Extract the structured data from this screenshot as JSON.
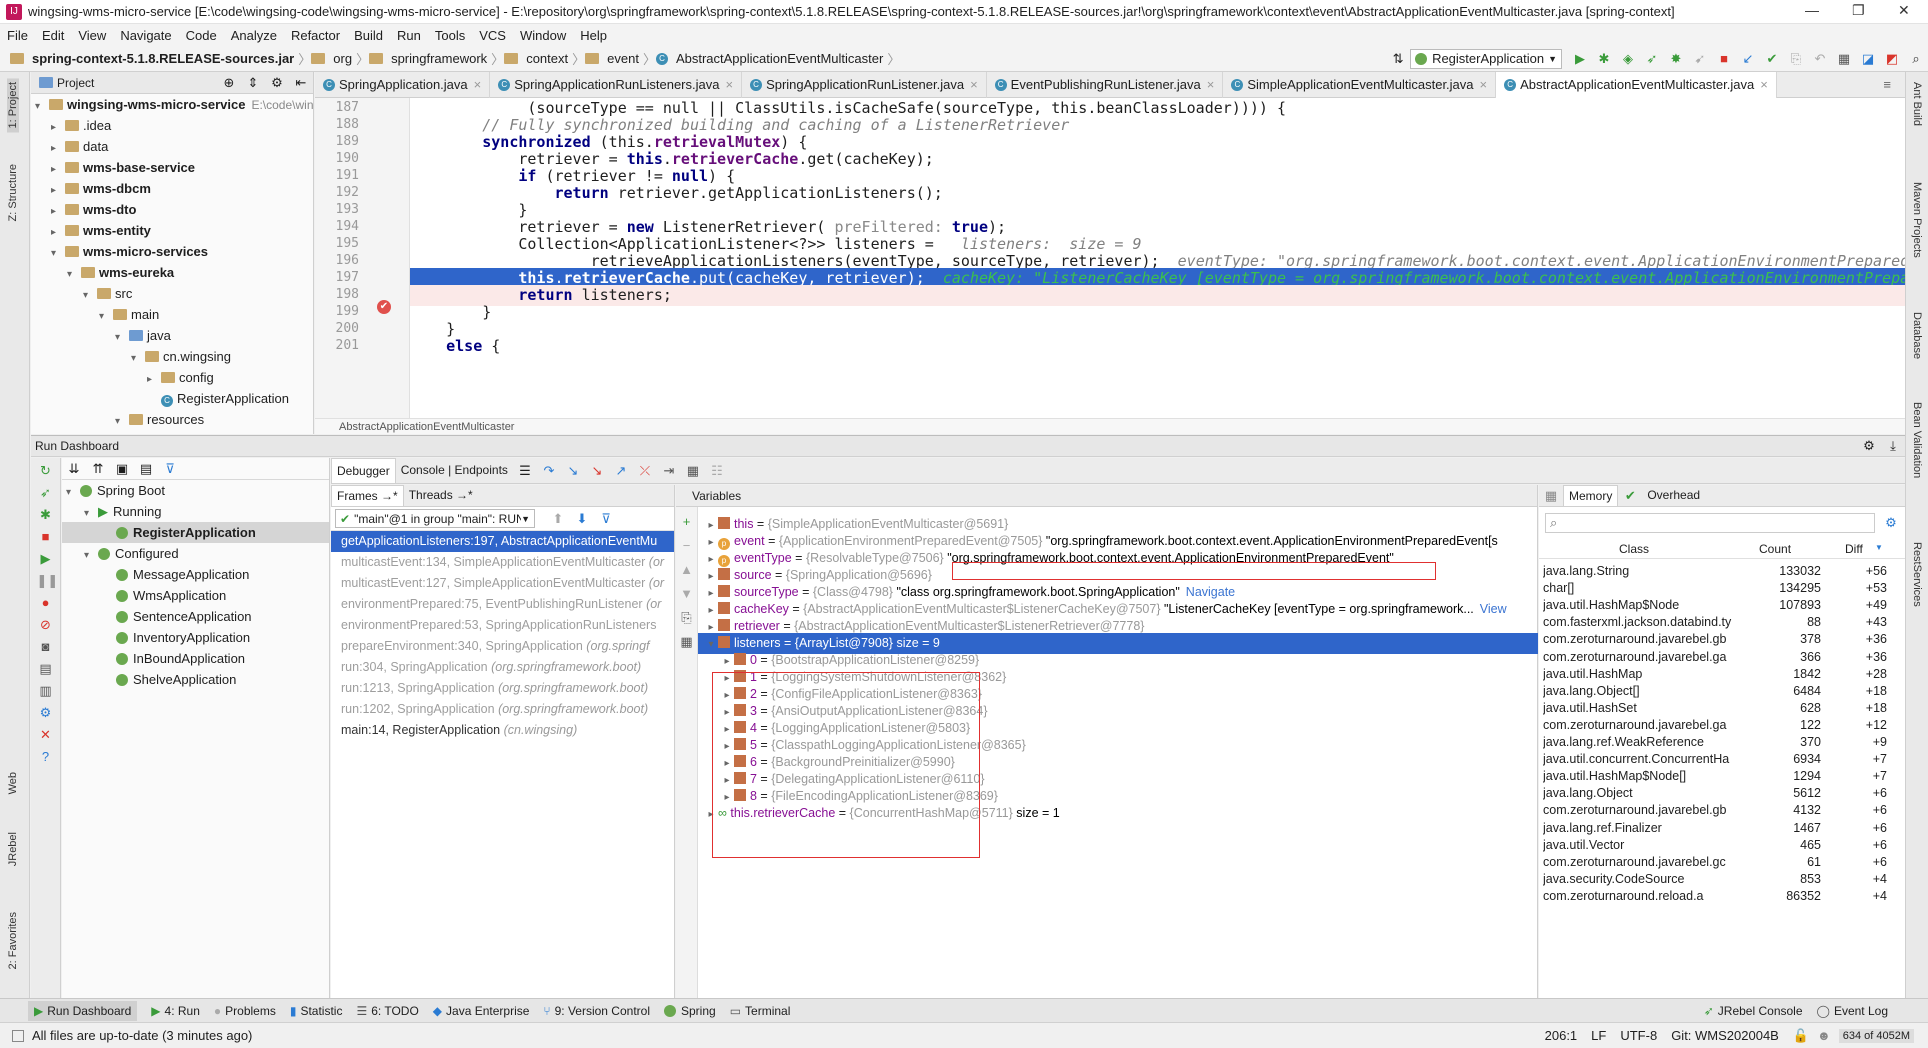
{
  "window": {
    "title": "wingsing-wms-micro-service [E:\\code\\wingsing-code\\wingsing-wms-micro-service] - E:\\repository\\org\\springframework\\spring-context\\5.1.8.RELEASE\\spring-context-5.1.8.RELEASE-sources.jar!\\org\\springframework\\context\\event\\AbstractApplicationEventMulticaster.java [spring-context]",
    "minimize": "—",
    "maximize": "❐",
    "close": "✕"
  },
  "menu": [
    "File",
    "Edit",
    "View",
    "Navigate",
    "Code",
    "Analyze",
    "Refactor",
    "Build",
    "Run",
    "Tools",
    "VCS",
    "Window",
    "Help"
  ],
  "breadcrumb": [
    "spring-context-5.1.8.RELEASE-sources.jar",
    "org",
    "springframework",
    "context",
    "event",
    "AbstractApplicationEventMulticaster"
  ],
  "run_config": "RegisterApplication",
  "left_strip": [
    "1: Project",
    "Z: Structure",
    "Web",
    "JRebel",
    "2: Favorites"
  ],
  "right_strip": [
    "Ant Build",
    "Maven Projects",
    "Database",
    "Bean Validation",
    "RestServices"
  ],
  "project": {
    "header": "Project",
    "items": [
      {
        "label": "wingsing-wms-micro-service",
        "extra": "E:\\code\\wing",
        "depth": 0,
        "arrow": "▾",
        "bold": true
      },
      {
        "label": ".idea",
        "depth": 1,
        "arrow": "▸"
      },
      {
        "label": "data",
        "depth": 1,
        "arrow": "▸"
      },
      {
        "label": "wms-base-service",
        "depth": 1,
        "arrow": "▸",
        "bold": true
      },
      {
        "label": "wms-dbcm",
        "depth": 1,
        "arrow": "▸",
        "bold": true
      },
      {
        "label": "wms-dto",
        "depth": 1,
        "arrow": "▸",
        "bold": true
      },
      {
        "label": "wms-entity",
        "depth": 1,
        "arrow": "▸",
        "bold": true
      },
      {
        "label": "wms-micro-services",
        "depth": 1,
        "arrow": "▾",
        "bold": true
      },
      {
        "label": "wms-eureka",
        "depth": 2,
        "arrow": "▾",
        "bold": true
      },
      {
        "label": "src",
        "depth": 3,
        "arrow": "▾"
      },
      {
        "label": "main",
        "depth": 4,
        "arrow": "▾"
      },
      {
        "label": "java",
        "depth": 5,
        "arrow": "▾",
        "blue": true
      },
      {
        "label": "cn.wingsing",
        "depth": 6,
        "arrow": "▾"
      },
      {
        "label": "config",
        "depth": 7,
        "arrow": "▸"
      },
      {
        "label": "RegisterApplication",
        "depth": 7,
        "arrow": "",
        "cls": true
      },
      {
        "label": "resources",
        "depth": 5,
        "arrow": "▾"
      }
    ]
  },
  "editor": {
    "tabs": [
      {
        "label": "SpringApplication.java",
        "active": false
      },
      {
        "label": "SpringApplicationRunListeners.java",
        "active": false
      },
      {
        "label": "SpringApplicationRunListener.java",
        "active": false
      },
      {
        "label": "EventPublishingRunListener.java",
        "active": false
      },
      {
        "label": "SimpleApplicationEventMulticaster.java",
        "active": false
      },
      {
        "label": "AbstractApplicationEventMulticaster.java",
        "active": true
      }
    ],
    "line_numbers": [
      "187",
      "188",
      "189",
      "190",
      "191",
      "192",
      "193",
      "194",
      "195",
      "196",
      "197",
      "198",
      "199",
      "200",
      "201"
    ],
    "footer": "AbstractApplicationEventMulticaster",
    "lines": {
      "l187": "(sourceType == null || ClassUtils.isCacheSafe(sourceType, this.beanClassLoader)))) {",
      "l188": "// Fully synchronized building and caching of a ListenerRetriever",
      "l189a": "synchronized",
      "l189b": " (this.",
      "l189c": "retrievalMutex",
      "l189d": ") {",
      "l190a": "retriever = ",
      "l190b": "this",
      "l190c": ".",
      "l190d": "retrieverCache",
      "l190e": ".get(cacheKey);",
      "l191a": "if",
      "l191b": " (retriever != ",
      "l191c": "null",
      "l191d": ") {",
      "l192a": "return",
      "l192b": " retriever.getApplicationListeners();",
      "l193": "}",
      "l194a": "retriever = ",
      "l194b": "new",
      "l194c": " ListenerRetriever( ",
      "l194d": "preFiltered:",
      "l194e": " true",
      "l194f": ");",
      "l195a": "Collection<ApplicationListener<?>> listeners = ",
      "l195b": "listeners:  size = 9",
      "l196a": "retrieveApplicationListeners(eventType, sourceType, retriever);",
      "l196b": "eventType: \"org.springframework.boot.context.event.ApplicationEnvironmentPreparedEvent\"",
      "l197a": "this",
      "l197b": ".",
      "l197c": "retrieverCache",
      "l197d": ".put(cacheKey, retriever);",
      "l197e": "cacheKey: \"ListenerCacheKey [eventType = org.springframework.boot.context.event.ApplicationEnvironmentPreparedEvent",
      "l198a": "return",
      "l198b": " listeners;",
      "l199": "}",
      "l200": "}",
      "l201a": "else",
      "l201b": " {"
    }
  },
  "run_dashboard": {
    "title": "Run Dashboard",
    "tree": [
      {
        "label": "Spring Boot",
        "depth": 0,
        "arrow": "▾"
      },
      {
        "label": "Running",
        "depth": 1,
        "arrow": "▾",
        "run": true
      },
      {
        "label": "RegisterApplication",
        "depth": 2,
        "arrow": "",
        "selected": true
      },
      {
        "label": "Configured",
        "depth": 1,
        "arrow": "▾"
      },
      {
        "label": "MessageApplication",
        "depth": 2,
        "arrow": ""
      },
      {
        "label": "WmsApplication",
        "depth": 2,
        "arrow": ""
      },
      {
        "label": "SentenceApplication",
        "depth": 2,
        "arrow": ""
      },
      {
        "label": "InventoryApplication",
        "depth": 2,
        "arrow": ""
      },
      {
        "label": "InBoundApplication",
        "depth": 2,
        "arrow": ""
      },
      {
        "label": "ShelveApplication",
        "depth": 2,
        "arrow": ""
      }
    ]
  },
  "debugger": {
    "tabs": [
      "Debugger",
      "Console | Endpoints"
    ],
    "frames_tab": "Frames →*",
    "threads_tab": "Threads →*",
    "thread_select": "\"main\"@1 in group \"main\": RUNN...",
    "frames": [
      {
        "m": "getApplicationListeners:197, AbstractApplicationEventMu",
        "c": "",
        "style": "sel"
      },
      {
        "m": "multicastEvent:134, SimpleApplicationEventMulticaster ",
        "c": "(or",
        "style": "dim"
      },
      {
        "m": "multicastEvent:127, SimpleApplicationEventMulticaster ",
        "c": "(or",
        "style": "dim"
      },
      {
        "m": "environmentPrepared:75, EventPublishingRunListener ",
        "c": "(or",
        "style": "dim"
      },
      {
        "m": "environmentPrepared:53, SpringApplicationRunListeners",
        "c": "",
        "style": "dim"
      },
      {
        "m": "prepareEnvironment:340, SpringApplication ",
        "c": "(org.springf",
        "style": "dim"
      },
      {
        "m": "run:304, SpringApplication ",
        "c": "(org.springframework.boot)",
        "style": "dim"
      },
      {
        "m": "run:1213, SpringApplication ",
        "c": "(org.springframework.boot)",
        "style": "dim"
      },
      {
        "m": "run:1202, SpringApplication ",
        "c": "(org.springframework.boot)",
        "style": "dim"
      },
      {
        "m": "main:14, RegisterApplication ",
        "c": "(cn.wingsing)",
        "style": ""
      }
    ],
    "variables_title": "Variables",
    "variables": [
      {
        "name": "this",
        "type": "{SimpleApplicationEventMulticaster@5691}",
        "value": "",
        "badge": "",
        "arrow": "▸",
        "depth": 0
      },
      {
        "name": "event",
        "type": "{ApplicationEnvironmentPreparedEvent@7505}",
        "value": "\"org.springframework.boot.context.event.ApplicationEnvironmentPreparedEvent[s",
        "badge": "p",
        "arrow": "▸",
        "depth": 0
      },
      {
        "name": "eventType",
        "type": "{ResolvableType@7506}",
        "value": "\"org.springframework.boot.context.event.ApplicationEnvironmentPreparedEvent\"",
        "badge": "p",
        "arrow": "▸",
        "depth": 0
      },
      {
        "name": "source",
        "type": "{SpringApplication@5696}",
        "value": "",
        "badge": "",
        "arrow": "▸",
        "depth": 0
      },
      {
        "name": "sourceType",
        "type": "{Class@4798}",
        "value": "\"class org.springframework.boot.SpringApplication\"",
        "extra": "Navigate",
        "badge": "",
        "arrow": "▸",
        "depth": 0
      },
      {
        "name": "cacheKey",
        "type": "{AbstractApplicationEventMulticaster$ListenerCacheKey@7507}",
        "value": "\"ListenerCacheKey [eventType = org.springframework...",
        "extra": "View",
        "badge": "",
        "arrow": "▸",
        "depth": 0
      },
      {
        "name": "retriever",
        "type": "{AbstractApplicationEventMulticaster$ListenerRetriever@7778}",
        "value": "",
        "badge": "",
        "arrow": "▸",
        "depth": 0
      },
      {
        "name": "listeners",
        "type": "{ArrayList@7908}",
        "value": " size = 9",
        "badge": "",
        "arrow": "▾",
        "depth": 0,
        "selected": true
      },
      {
        "name": "0",
        "type": "{BootstrapApplicationListener@8259}",
        "value": "",
        "badge": "",
        "arrow": "▸",
        "depth": 1
      },
      {
        "name": "1",
        "type": "{LoggingSystemShutdownListener@8362}",
        "value": "",
        "badge": "",
        "arrow": "▸",
        "depth": 1
      },
      {
        "name": "2",
        "type": "{ConfigFileApplicationListener@8363}",
        "value": "",
        "badge": "",
        "arrow": "▸",
        "depth": 1
      },
      {
        "name": "3",
        "type": "{AnsiOutputApplicationListener@8364}",
        "value": "",
        "badge": "",
        "arrow": "▸",
        "depth": 1
      },
      {
        "name": "4",
        "type": "{LoggingApplicationListener@5803}",
        "value": "",
        "badge": "",
        "arrow": "▸",
        "depth": 1
      },
      {
        "name": "5",
        "type": "{ClasspathLoggingApplicationListener@8365}",
        "value": "",
        "badge": "",
        "arrow": "▸",
        "depth": 1
      },
      {
        "name": "6",
        "type": "{BackgroundPreinitializer@5990}",
        "value": "",
        "badge": "",
        "arrow": "▸",
        "depth": 1
      },
      {
        "name": "7",
        "type": "{DelegatingApplicationListener@6110}",
        "value": "",
        "badge": "",
        "arrow": "▸",
        "depth": 1
      },
      {
        "name": "8",
        "type": "{FileEncodingApplicationListener@8369}",
        "value": "",
        "badge": "",
        "arrow": "▸",
        "depth": 1
      },
      {
        "name": "this.retrieverCache",
        "type": "{ConcurrentHashMap@5711}",
        "value": " size = 1",
        "badge": "oo",
        "arrow": "▸",
        "depth": 0
      }
    ]
  },
  "memory": {
    "tab": "Memory",
    "overhead_tab": "Overhead",
    "columns": [
      "Class",
      "Count",
      "Diff"
    ],
    "rows": [
      [
        "java.lang.String",
        "133032",
        "+56"
      ],
      [
        "char[]",
        "134295",
        "+53"
      ],
      [
        "java.util.HashMap$Node",
        "107893",
        "+49"
      ],
      [
        "com.fasterxml.jackson.databind.ty",
        "88",
        "+43"
      ],
      [
        "com.zeroturnaround.javarebel.gb",
        "378",
        "+36"
      ],
      [
        "com.zeroturnaround.javarebel.ga",
        "366",
        "+36"
      ],
      [
        "java.util.HashMap",
        "1842",
        "+28"
      ],
      [
        "java.lang.Object[]",
        "6484",
        "+18"
      ],
      [
        "java.util.HashSet",
        "628",
        "+18"
      ],
      [
        "com.zeroturnaround.javarebel.ga",
        "122",
        "+12"
      ],
      [
        "java.lang.ref.WeakReference",
        "370",
        "+9"
      ],
      [
        "java.util.concurrent.ConcurrentHa",
        "6934",
        "+7"
      ],
      [
        "java.util.HashMap$Node[]",
        "1294",
        "+7"
      ],
      [
        "java.lang.Object",
        "5612",
        "+6"
      ],
      [
        "com.zeroturnaround.javarebel.gb",
        "4132",
        "+6"
      ],
      [
        "java.lang.ref.Finalizer",
        "1467",
        "+6"
      ],
      [
        "java.util.Vector",
        "465",
        "+6"
      ],
      [
        "com.zeroturnaround.javarebel.gc",
        "61",
        "+6"
      ],
      [
        "java.security.CodeSource",
        "853",
        "+4"
      ],
      [
        "com.zeroturnaround.reload.a",
        "86352",
        "+4"
      ]
    ]
  },
  "bottom_tools": [
    "Run Dashboard",
    "4: Run",
    "Problems",
    "Statistic",
    "6: TODO",
    "Java Enterprise",
    "9: Version Control",
    "Spring",
    "Terminal"
  ],
  "bottom_right": [
    "JRebel Console",
    "Event Log"
  ],
  "status": {
    "message": "All files are up-to-date (3 minutes ago)",
    "position": "206:1",
    "line_sep": "LF",
    "encoding": "UTF-8",
    "git": "Git: WMS202004B",
    "memory": "634 of 4052M"
  }
}
